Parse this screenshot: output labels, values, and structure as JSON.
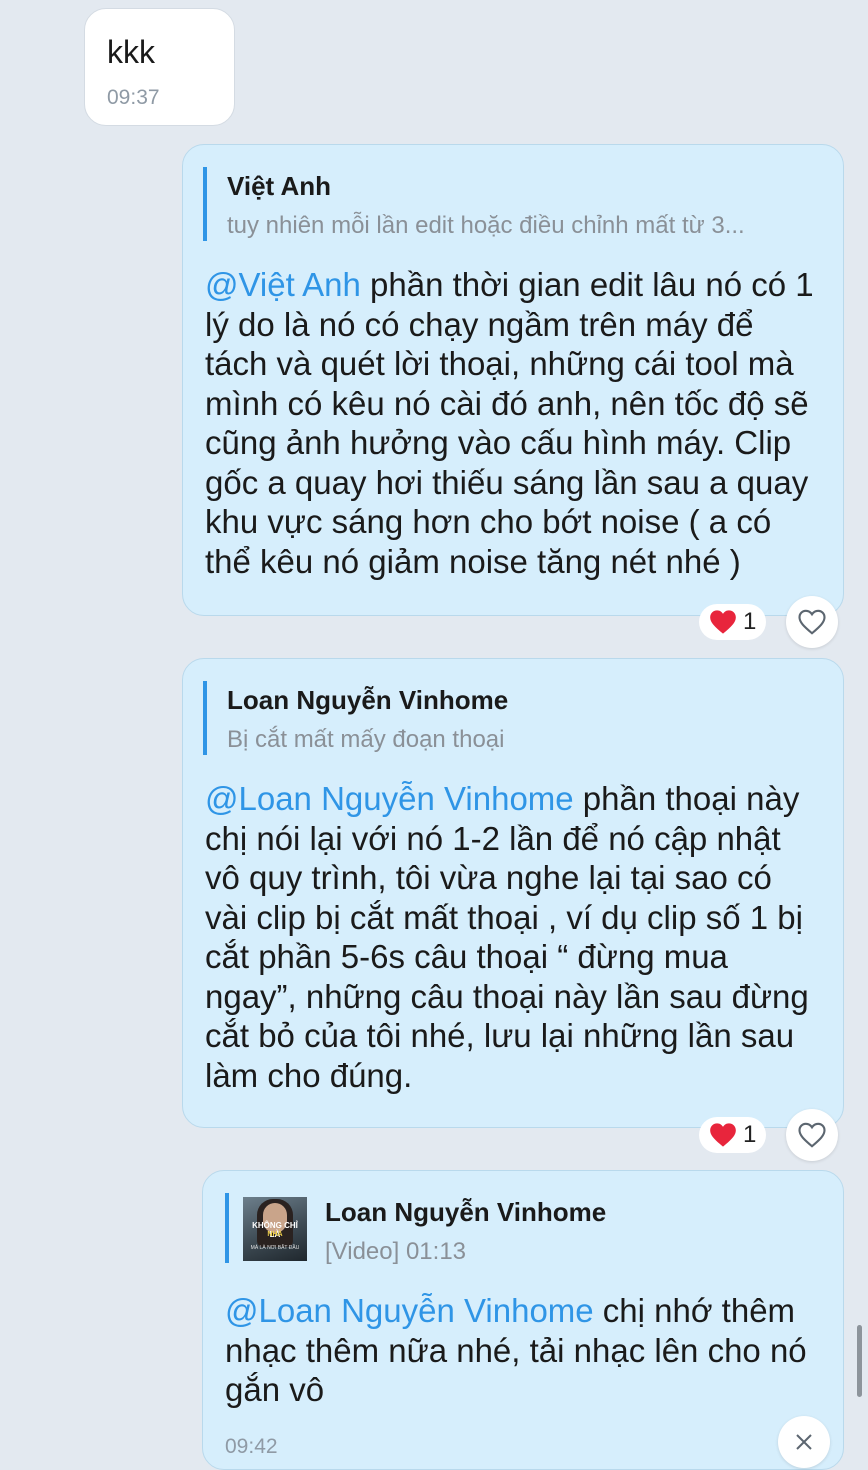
{
  "messages": [
    {
      "type": "incoming",
      "text": "kkk",
      "time": "09:37"
    },
    {
      "type": "outgoing",
      "quote": {
        "name": "Việt Anh",
        "preview": "tuy nhiên mỗi lần edit hoặc điều chỉnh mất từ 3..."
      },
      "mention": "@Việt Anh",
      "lines": [
        " phần thời gian edit lâu nó có 1",
        "lý do là nó có chạy ngầm trên máy để",
        "tách và quét lời thoại, những cái tool mà",
        "mình có kêu nó cài đó anh, nên tốc độ sẽ",
        "cũng ảnh hưởng vào cấu hình máy. Clip",
        "gốc a quay hơi thiếu sáng lần sau a quay",
        "khu vực sáng hơn cho bớt noise ( a có",
        "thể kêu nó giảm noise tăng nét nhé )"
      ],
      "reaction": {
        "icon": "heart-icon",
        "count": "1"
      }
    },
    {
      "type": "outgoing",
      "quote": {
        "name": "Loan Nguyễn Vinhome",
        "preview": "Bị cắt mất mấy đoạn thoại"
      },
      "mention": "@Loan Nguyễn Vinhome",
      "lines": [
        " phần thoại này",
        "chị nói lại với nó 1-2 lần để nó cập nhật",
        "vô quy trình, tôi vừa nghe lại tại sao có",
        "vài clip bị cắt mất thoại , ví dụ clip số 1 bị",
        "cắt phần 5-6s câu thoại “ đừng mua",
        "ngay”, những câu thoại này lần sau đừng",
        "cắt bỏ của tôi nhé, lưu lại những lần sau",
        "làm cho đúng."
      ],
      "reaction": {
        "icon": "heart-icon",
        "count": "1"
      }
    },
    {
      "type": "outgoing",
      "quote": {
        "name": "Loan Nguyễn Vinhome",
        "preview": "[Video] 01:13",
        "thumb": {
          "line1": "KHÔNG CHỈ LÀ",
          "line2": "NHÀ",
          "line3": "MÀ LÀ NƠI BẮT ĐẦU"
        }
      },
      "mention": "@Loan Nguyễn Vinhome",
      "lines": [
        " chị nhớ thêm",
        "nhạc thêm nữa nhé, tải nhạc lên cho nó",
        "gắn vô"
      ],
      "time": "09:42"
    }
  ],
  "colors": {
    "background": "#e3e9f0",
    "outgoing_bubble": "#d6eefc",
    "incoming_bubble": "#ffffff",
    "mention": "#2f95e6",
    "heart": "#e8253c"
  }
}
